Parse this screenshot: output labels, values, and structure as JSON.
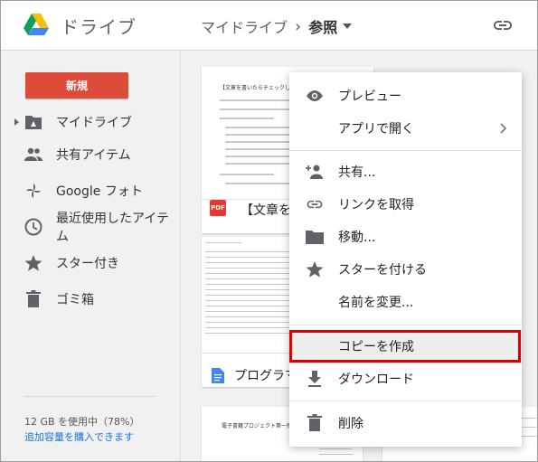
{
  "header": {
    "app_title": "ドライブ",
    "breadcrumb": {
      "parent": "マイドライブ",
      "separator": "›",
      "current": "参照"
    }
  },
  "sidebar": {
    "new_button": "新規",
    "items": [
      {
        "label": "マイドライブ",
        "icon": "drive-folder-icon"
      },
      {
        "label": "共有アイテム",
        "icon": "people-icon"
      },
      {
        "label": "Google フォト",
        "icon": "photos-pinwheel-icon"
      },
      {
        "label": "最近使用したアイテム",
        "icon": "clock-icon"
      },
      {
        "label": "スター付き",
        "icon": "star-icon"
      },
      {
        "label": "ゴミ箱",
        "icon": "trash-icon"
      }
    ],
    "storage_text": "12 GB を使用中（78%）",
    "storage_link": "追加容量を購入できます"
  },
  "files": [
    {
      "name": "【文章を書",
      "type_badge": "PDF",
      "preview_title": "【文章を書いたらチェックしたい17の項目"
    },
    {
      "name": "プログラマ",
      "type_badge": "doc"
    },
    {
      "name": "",
      "preview_title": "電子書籍プロジェクト第一弾"
    }
  ],
  "context_menu": {
    "items": [
      {
        "label": "プレビュー",
        "icon": "eye-icon"
      },
      {
        "label": "アプリで開く",
        "icon": "",
        "submenu": true
      },
      {
        "label": "共有...",
        "icon": "add-person-icon"
      },
      {
        "label": "リンクを取得",
        "icon": "link-icon"
      },
      {
        "label": "移動...",
        "icon": "folder-icon"
      },
      {
        "label": "スターを付ける",
        "icon": "star-icon"
      },
      {
        "label": "名前を変更...",
        "icon": ""
      },
      {
        "label": "コピーを作成",
        "icon": "",
        "highlighted": true
      },
      {
        "label": "ダウンロード",
        "icon": "download-icon"
      },
      {
        "label": "削除",
        "icon": "trash-icon"
      }
    ]
  },
  "colors": {
    "new_button": "#dd4b39",
    "highlight_outline": "#e00000",
    "link": "#1a73e8",
    "pdf_badge": "#e53935",
    "doc_badge": "#4285f4"
  }
}
